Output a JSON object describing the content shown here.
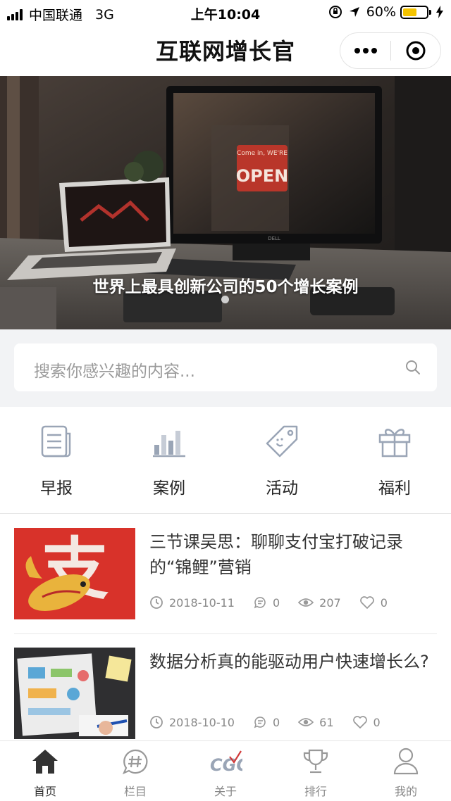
{
  "status_bar": {
    "carrier": "中国联通",
    "network": "3G",
    "time": "上午10:04",
    "battery": "60%",
    "battery_level": 0.6,
    "battery_color": "#f5c400"
  },
  "navbar": {
    "title": "互联网增长官",
    "menu_icon": "more-dots-icon",
    "close_icon": "target-close-icon"
  },
  "banner": {
    "caption": "世界上最具创新公司的50个增长案例",
    "sign_text": "OPEN",
    "sign_small": "Come in, WE'RE",
    "brand": "DELL"
  },
  "search": {
    "placeholder": "搜索你感兴趣的内容..."
  },
  "categories": [
    {
      "label": "早报",
      "icon": "newspaper-icon"
    },
    {
      "label": "案例",
      "icon": "bar-chart-icon"
    },
    {
      "label": "活动",
      "icon": "tag-icon"
    },
    {
      "label": "福利",
      "icon": "gift-icon"
    }
  ],
  "articles": [
    {
      "title": "三节课吴思：聊聊支付宝打破记录的“锦鲤”营销",
      "date": "2018-10-11",
      "comments": "0",
      "views": "207",
      "likes": "0",
      "thumb_text": "支"
    },
    {
      "title": "数据分析真的能驱动用户快速增长么?",
      "date": "2018-10-10",
      "comments": "0",
      "views": "61",
      "likes": "0"
    }
  ],
  "tabbar": [
    {
      "label": "首页",
      "icon": "home-icon",
      "active": true
    },
    {
      "label": "栏目",
      "icon": "hashtag-chat-icon",
      "active": false
    },
    {
      "label": "关于",
      "icon": "cgo-logo-icon",
      "active": false,
      "logo_text": "CGO"
    },
    {
      "label": "排行",
      "icon": "trophy-icon",
      "active": false
    },
    {
      "label": "我的",
      "icon": "user-icon",
      "active": false
    }
  ],
  "colors": {
    "accent": "#333333",
    "muted": "#888888",
    "search_bg": "#f2f3f5"
  }
}
